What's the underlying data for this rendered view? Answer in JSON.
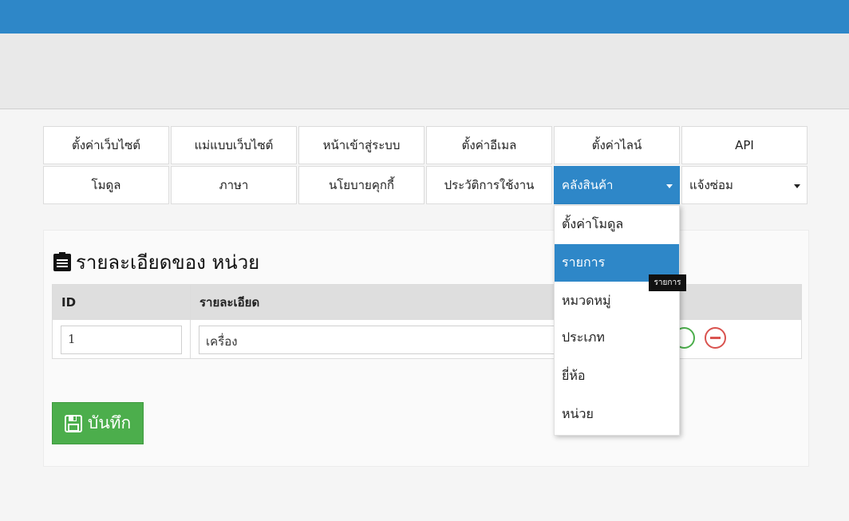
{
  "nav": {
    "row1": [
      "ตั้งค่าเว็บไซต์",
      "แม่แบบเว็บไซต์",
      "หน้าเข้าสู่ระบบ",
      "ตั้งค่าอีเมล",
      "ตั้งค่าไลน์",
      "API"
    ],
    "row2": [
      "โมดูล",
      "ภาษา",
      "นโยบายคุกกี้",
      "ประวัติการใช้งาน",
      "คลังสินค้า",
      "แจ้งซ่อม"
    ]
  },
  "dropdown": {
    "items": [
      "ตั้งค่าโมดูล",
      "รายการ",
      "หมวดหมู่",
      "ประเภท",
      "ยี่ห้อ",
      "หน่วย"
    ],
    "active_index": 1,
    "tooltip": "รายการ"
  },
  "panel": {
    "title": "รายละเอียดของ หน่วย",
    "columns": [
      "ID",
      "รายละเอียด"
    ],
    "rows": [
      {
        "id": "1",
        "detail": "เครื่อง"
      }
    ],
    "save_label": "บันทึก"
  },
  "colors": {
    "topbar": "#2e87c8",
    "active": "#2e87c8",
    "save": "#4cae4c",
    "remove": "#d9534f"
  }
}
